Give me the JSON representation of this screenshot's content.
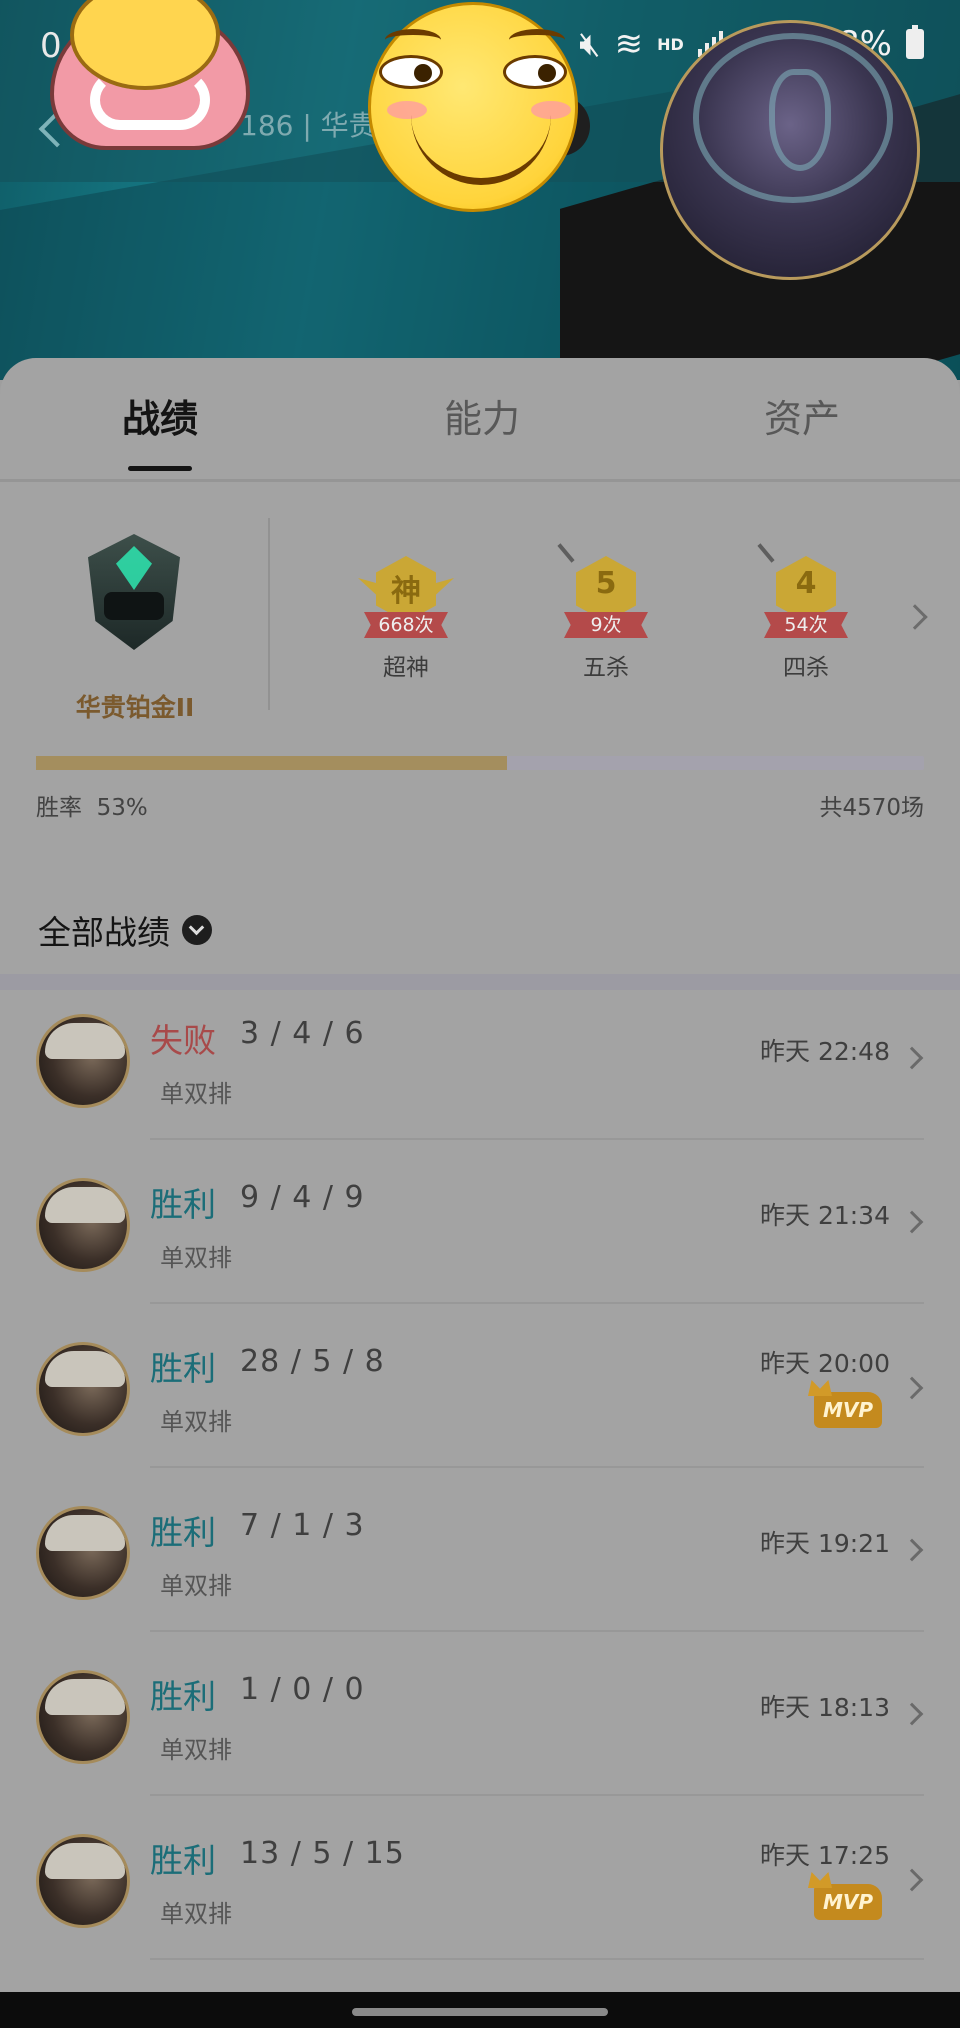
{
  "status_bar": {
    "time": "0",
    "hd_1": "HD",
    "hd_2": "HD",
    "battery": "98%"
  },
  "header": {
    "subtitle": "186 | 华贵铂"
  },
  "tabs": [
    {
      "label": "战绩",
      "active": true
    },
    {
      "label": "能力",
      "active": false
    },
    {
      "label": "资产",
      "active": false
    }
  ],
  "rank": {
    "name": "华贵铂金II",
    "win_rate_label": "胜率",
    "win_rate": "53%",
    "win_rate_fraction": 0.53,
    "total": "共4570场"
  },
  "medals": [
    {
      "glyph": "神",
      "count": "668次",
      "label": "超神"
    },
    {
      "glyph": "5",
      "count": "9次",
      "label": "五杀"
    },
    {
      "glyph": "4",
      "count": "54次",
      "label": "四杀"
    }
  ],
  "filter": {
    "label": "全部战绩"
  },
  "matches": [
    {
      "result": "失败",
      "outcome": "loss",
      "kda": "3 / 4 / 6",
      "mode": "单双排",
      "time": "昨天 22:48",
      "mvp": ""
    },
    {
      "result": "胜利",
      "outcome": "win",
      "kda": "9 / 4 / 9",
      "mode": "单双排",
      "time": "昨天 21:34",
      "mvp": ""
    },
    {
      "result": "胜利",
      "outcome": "win",
      "kda": "28 / 5 / 8",
      "mode": "单双排",
      "time": "昨天 20:00",
      "mvp": "MVP"
    },
    {
      "result": "胜利",
      "outcome": "win",
      "kda": "7 / 1 / 3",
      "mode": "单双排",
      "time": "昨天 19:21",
      "mvp": ""
    },
    {
      "result": "胜利",
      "outcome": "win",
      "kda": "1 / 0 / 0",
      "mode": "单双排",
      "time": "昨天 18:13",
      "mvp": ""
    },
    {
      "result": "胜利",
      "outcome": "win",
      "kda": "13 / 5 / 15",
      "mode": "单双排",
      "time": "昨天 17:25",
      "mvp": "MVP"
    }
  ],
  "colors": {
    "win": "#1b6d78",
    "loss": "#a84a4a",
    "rank_gold": "#7b5a2e",
    "winbar_fill": "#a48e5e",
    "overlay_gray": "#a3a3a3"
  }
}
